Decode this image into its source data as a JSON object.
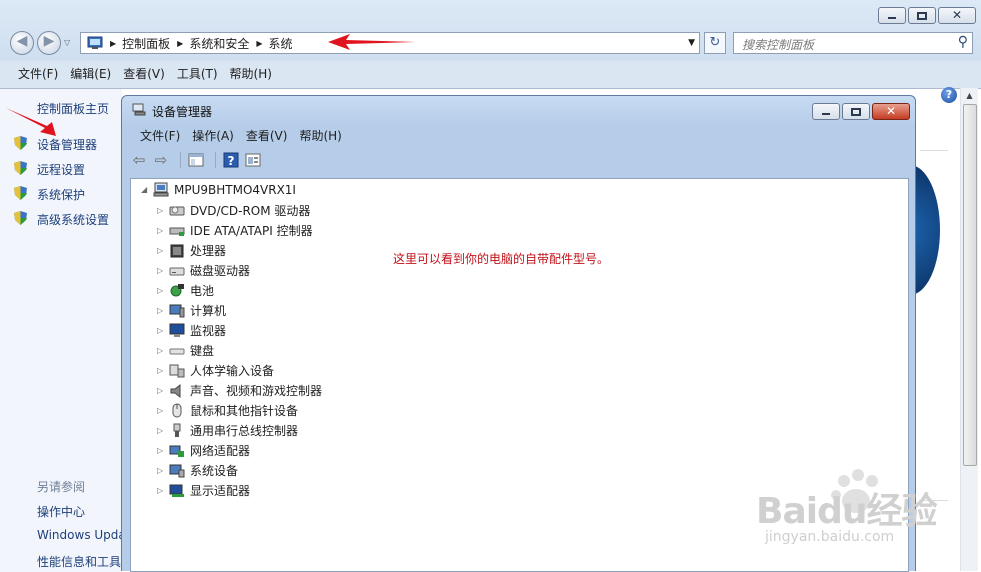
{
  "outer": {
    "address_crumbs": [
      "控制面板",
      "系统和安全",
      "系统"
    ],
    "search_placeholder": "搜索控制面板",
    "menu": [
      "文件(F)",
      "编辑(E)",
      "查看(V)",
      "工具(T)",
      "帮助(H)"
    ],
    "sidebar": {
      "home": "控制面板主页",
      "links": [
        "设备管理器",
        "远程设置",
        "系统保护",
        "高级系统设置"
      ],
      "see_also_title": "另请参阅",
      "see_also": [
        "操作中心",
        "Windows Upda",
        "性能信息和工具"
      ]
    }
  },
  "dialog": {
    "title": "设备管理器",
    "menu": [
      "文件(F)",
      "操作(A)",
      "查看(V)",
      "帮助(H)"
    ],
    "root": "MPU9BHTMO4VRX1I",
    "devices": [
      {
        "label": "DVD/CD-ROM 驱动器",
        "icon": "dvd-drive-icon"
      },
      {
        "label": "IDE ATA/ATAPI 控制器",
        "icon": "ide-controller-icon"
      },
      {
        "label": "处理器",
        "icon": "processor-icon"
      },
      {
        "label": "磁盘驱动器",
        "icon": "disk-drive-icon"
      },
      {
        "label": "电池",
        "icon": "battery-icon"
      },
      {
        "label": "计算机",
        "icon": "computer-icon"
      },
      {
        "label": "监视器",
        "icon": "monitor-icon"
      },
      {
        "label": "键盘",
        "icon": "keyboard-icon"
      },
      {
        "label": "人体学输入设备",
        "icon": "hid-icon"
      },
      {
        "label": "声音、视频和游戏控制器",
        "icon": "sound-icon"
      },
      {
        "label": "鼠标和其他指针设备",
        "icon": "mouse-icon"
      },
      {
        "label": "通用串行总线控制器",
        "icon": "usb-icon"
      },
      {
        "label": "网络适配器",
        "icon": "network-adapter-icon"
      },
      {
        "label": "系统设备",
        "icon": "system-device-icon"
      },
      {
        "label": "显示适配器",
        "icon": "display-adapter-icon"
      }
    ]
  },
  "annotation": "这里可以看到你的电脑的自带配件型号。",
  "watermark": {
    "top": "Baidu经验",
    "bottom": "jingyan.baidu.com"
  },
  "colors": {
    "annotation": "#c0121a",
    "arrow": "#e0141e",
    "link": "#1e3f7a"
  }
}
